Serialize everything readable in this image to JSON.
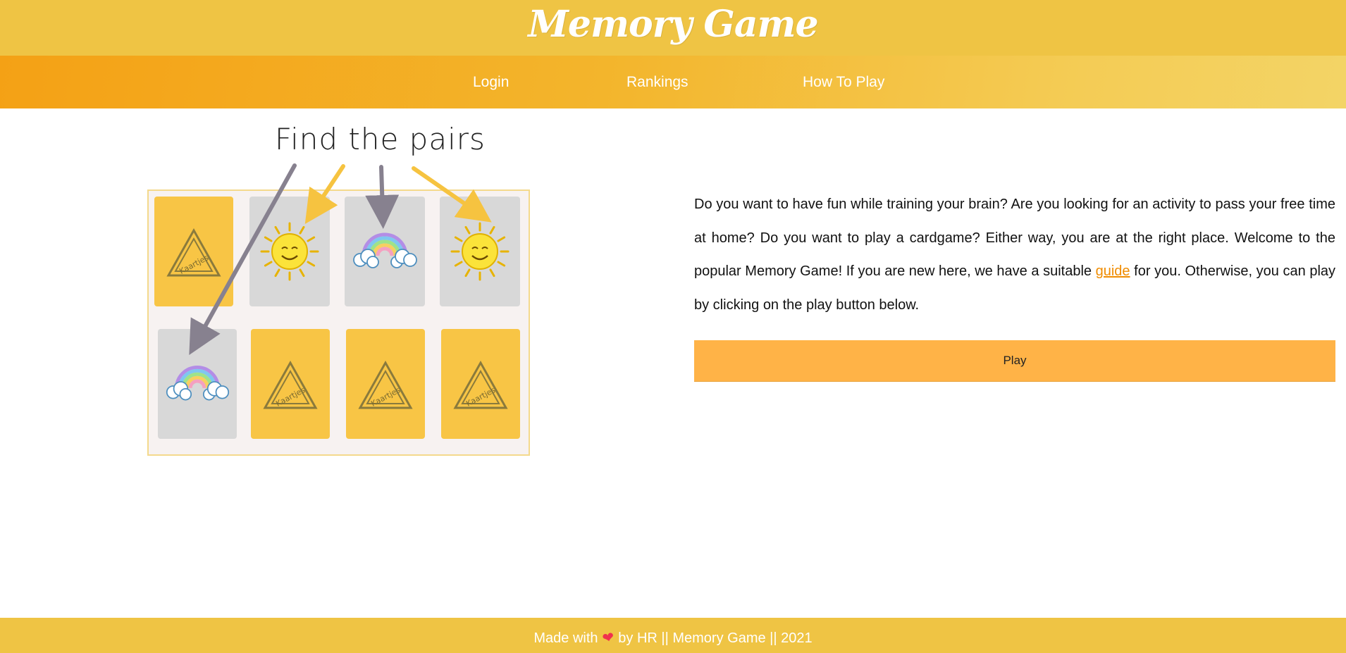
{
  "header": {
    "title": "Memory Game",
    "nav": [
      {
        "label": "Login"
      },
      {
        "label": "Rankings"
      },
      {
        "label": "How To Play"
      }
    ]
  },
  "illustration": {
    "caption": "Find the pairs",
    "card_logo_text": "Kaartjes",
    "cards": [
      {
        "state": "back",
        "icon": "triangle-logo-icon"
      },
      {
        "state": "face",
        "icon": "sun-icon"
      },
      {
        "state": "face",
        "icon": "rainbow-icon"
      },
      {
        "state": "face",
        "icon": "sun-icon"
      },
      {
        "state": "face",
        "icon": "rainbow-icon"
      },
      {
        "state": "back",
        "icon": "triangle-logo-icon"
      },
      {
        "state": "back",
        "icon": "triangle-logo-icon"
      },
      {
        "state": "back",
        "icon": "triangle-logo-icon"
      }
    ]
  },
  "intro": {
    "text_before_link": "Do you want to have fun while training your brain? Are you looking for an activity to pass your free time at home? Do you want to play a cardgame? Either way, you are at the right place. Welcome to the popular Memory Game! If you are new here, we have a suitable ",
    "link_text": "guide",
    "text_after_link": " for you. Otherwise, you can play by clicking on the play button below."
  },
  "play_button": {
    "label": "Play"
  },
  "footer": {
    "before_heart": "Made with",
    "after_heart": "by HR || Memory Game || 2021"
  },
  "colors": {
    "header": "#efc444",
    "nav_start": "#f4a115",
    "nav_end": "#f3d466",
    "play_button": "#ffb347",
    "link": "#f08c00",
    "card_back": "#f8c545",
    "card_face": "#d8d8d8"
  }
}
